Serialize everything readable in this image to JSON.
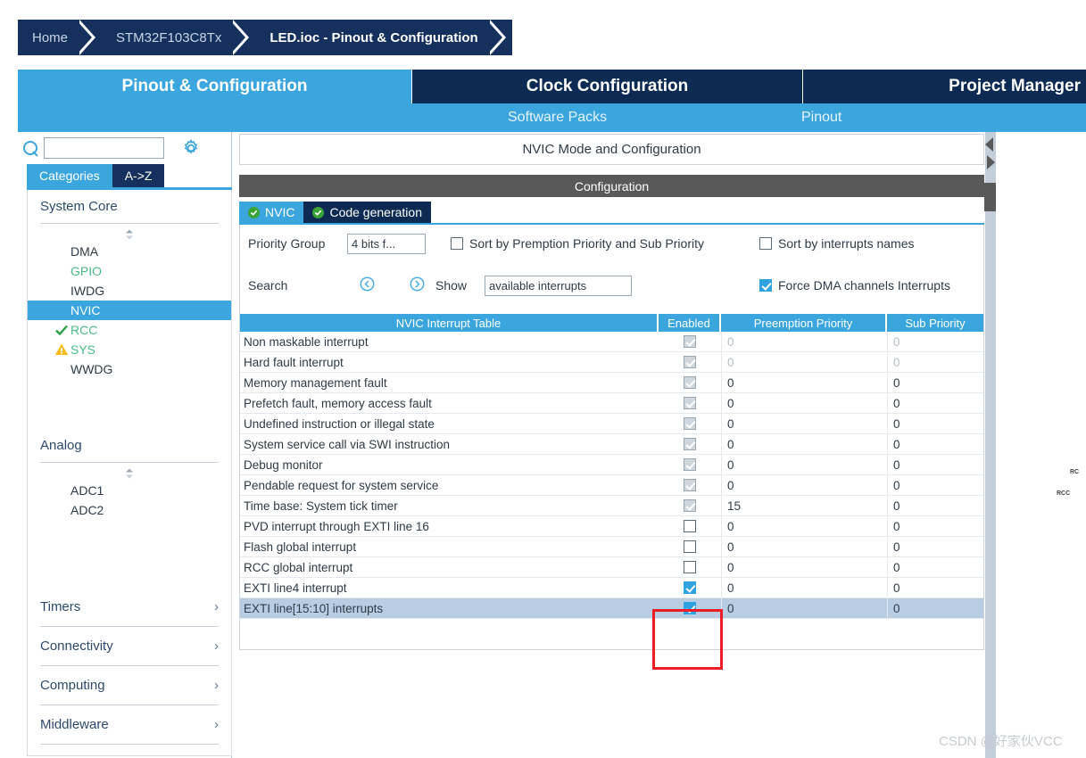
{
  "breadcrumb": {
    "items": [
      {
        "label": "Home",
        "active": false
      },
      {
        "label": "STM32F103C8Tx",
        "active": false
      },
      {
        "label": "LED.ioc - Pinout & Configuration",
        "active": true
      }
    ]
  },
  "main_tabs": [
    {
      "label": "Pinout & Configuration",
      "selected": true
    },
    {
      "label": "Clock Configuration",
      "selected": false
    },
    {
      "label": "Project Manager",
      "selected": false
    }
  ],
  "sub_nav": {
    "software_packs": "Software Packs",
    "pinout": "Pinout",
    "caret": "ⱟ"
  },
  "sidebar": {
    "search": {
      "value": "",
      "placeholder": ""
    },
    "view_tabs": [
      {
        "label": "Categories",
        "selected": true
      },
      {
        "label": "A->Z",
        "selected": false
      }
    ],
    "groups": [
      {
        "title": "System Core",
        "expanded": true,
        "items": [
          {
            "label": "DMA",
            "state": "none",
            "selected": false
          },
          {
            "label": "GPIO",
            "state": "configured",
            "selected": false
          },
          {
            "label": "IWDG",
            "state": "none",
            "selected": false
          },
          {
            "label": "NVIC",
            "state": "none",
            "selected": true
          },
          {
            "label": "RCC",
            "state": "ok",
            "selected": false
          },
          {
            "label": "SYS",
            "state": "warn",
            "selected": false
          },
          {
            "label": "WWDG",
            "state": "none",
            "selected": false
          }
        ]
      },
      {
        "title": "Analog",
        "expanded": true,
        "items": [
          {
            "label": "ADC1",
            "state": "none",
            "selected": false
          },
          {
            "label": "ADC2",
            "state": "none",
            "selected": false
          }
        ]
      }
    ],
    "collapsed_groups": [
      {
        "title": "Timers"
      },
      {
        "title": "Connectivity"
      },
      {
        "title": "Computing"
      },
      {
        "title": "Middleware"
      }
    ]
  },
  "config": {
    "mode_header": "NVIC Mode and Configuration",
    "configuration_header": "Configuration",
    "tabs": [
      {
        "label": "NVIC",
        "selected": true
      },
      {
        "label": "Code generation",
        "selected": false
      }
    ],
    "priority_group_label": "Priority Group",
    "priority_group_value": "4 bits f...",
    "sort_premption_label": "Sort by Premption Priority and Sub Priority",
    "sort_premption_checked": false,
    "sort_names_label": "Sort by interrupts names",
    "sort_names_checked": false,
    "search_label": "Search",
    "show_label": "Show",
    "show_value": "available interrupts",
    "force_dma_label": "Force DMA channels Interrupts",
    "force_dma_checked": true
  },
  "table": {
    "columns": [
      "NVIC Interrupt Table",
      "Enabled",
      "Preemption Priority",
      "Sub Priority"
    ],
    "rows": [
      {
        "name": "Non maskable interrupt",
        "enabled": true,
        "locked": true,
        "dim": true,
        "preemption": "0",
        "sub": "0",
        "selected": false
      },
      {
        "name": "Hard fault interrupt",
        "enabled": true,
        "locked": true,
        "dim": true,
        "preemption": "0",
        "sub": "0",
        "selected": false
      },
      {
        "name": "Memory management fault",
        "enabled": true,
        "locked": true,
        "dim": false,
        "preemption": "0",
        "sub": "0",
        "selected": false
      },
      {
        "name": "Prefetch fault, memory access fault",
        "enabled": true,
        "locked": true,
        "dim": false,
        "preemption": "0",
        "sub": "0",
        "selected": false
      },
      {
        "name": "Undefined instruction or illegal state",
        "enabled": true,
        "locked": true,
        "dim": false,
        "preemption": "0",
        "sub": "0",
        "selected": false
      },
      {
        "name": "System service call via SWI instruction",
        "enabled": true,
        "locked": true,
        "dim": false,
        "preemption": "0",
        "sub": "0",
        "selected": false
      },
      {
        "name": "Debug monitor",
        "enabled": true,
        "locked": true,
        "dim": false,
        "preemption": "0",
        "sub": "0",
        "selected": false
      },
      {
        "name": "Pendable request for system service",
        "enabled": true,
        "locked": true,
        "dim": false,
        "preemption": "0",
        "sub": "0",
        "selected": false
      },
      {
        "name": "Time base: System tick timer",
        "enabled": true,
        "locked": true,
        "dim": false,
        "preemption": "15",
        "sub": "0",
        "selected": false
      },
      {
        "name": "PVD interrupt through EXTI line 16",
        "enabled": false,
        "locked": false,
        "dim": false,
        "preemption": "0",
        "sub": "0",
        "selected": false
      },
      {
        "name": "Flash global interrupt",
        "enabled": false,
        "locked": false,
        "dim": false,
        "preemption": "0",
        "sub": "0",
        "selected": false
      },
      {
        "name": "RCC global interrupt",
        "enabled": false,
        "locked": false,
        "dim": false,
        "preemption": "0",
        "sub": "0",
        "selected": false
      },
      {
        "name": "EXTI line4 interrupt",
        "enabled": true,
        "locked": false,
        "dim": false,
        "preemption": "0",
        "sub": "0",
        "selected": false
      },
      {
        "name": "EXTI line[15:10] interrupts",
        "enabled": true,
        "locked": false,
        "dim": false,
        "preemption": "0",
        "sub": "0",
        "selected": true
      }
    ]
  },
  "annotation": {
    "color": "#ee1c25"
  },
  "right_pane": {
    "pin_labels": [
      "RC",
      "RCC"
    ]
  },
  "watermark": "CSDN @好家伙VCC",
  "colors": {
    "accent": "#3ba6dd",
    "dark_navy": "#15305c",
    "darker_navy": "#0c2a52",
    "header_gray": "#595959",
    "green": "#4cbb8a",
    "ok_green": "#3aa335",
    "warn_yellow": "#f5bb1d",
    "selection_blue": "#b9cde2",
    "annotation_red": "#ee1c25"
  }
}
